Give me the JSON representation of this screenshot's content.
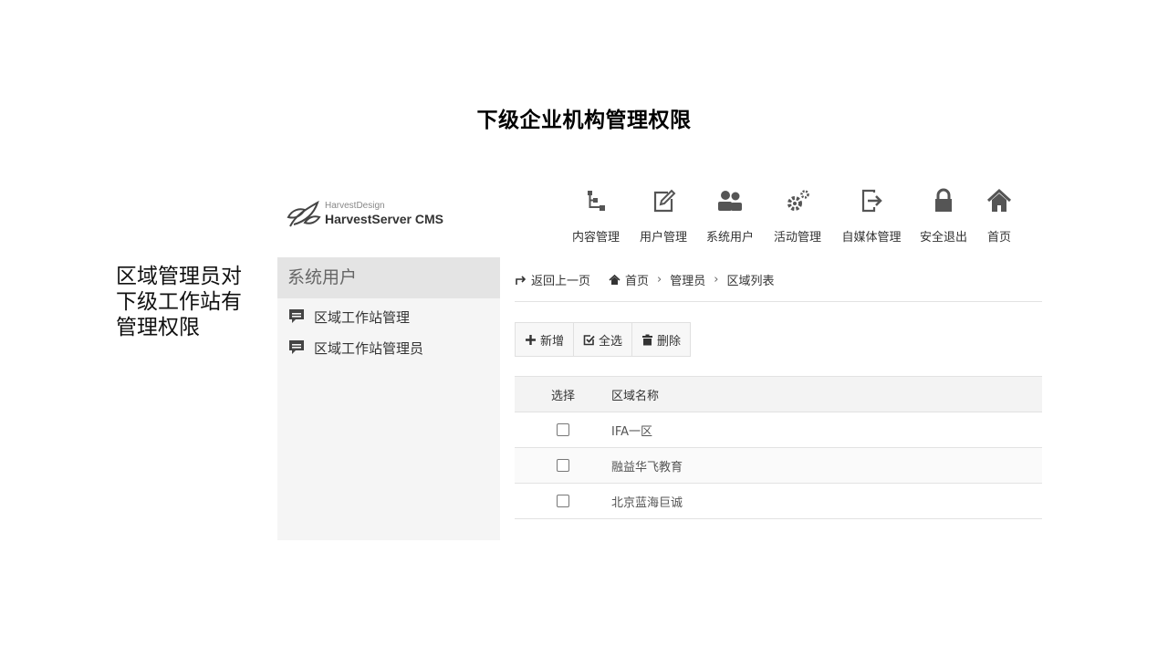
{
  "slide": {
    "title": "下级企业机构管理权限",
    "note_lines": [
      "区域管理员对",
      "下级工作站有",
      "管理权限"
    ]
  },
  "logo": {
    "small": "HarvestDesign",
    "big": "HarvestServer CMS"
  },
  "nav": [
    {
      "label": "内容管理",
      "icon": "sitemap-icon"
    },
    {
      "label": "用户管理",
      "icon": "edit-icon"
    },
    {
      "label": "系统用户",
      "icon": "users-icon"
    },
    {
      "label": "活动管理",
      "icon": "gears-icon"
    },
    {
      "label": "自媒体管理",
      "icon": "export-icon"
    },
    {
      "label": "安全退出",
      "icon": "lock-icon"
    },
    {
      "label": "首页",
      "icon": "home-icon"
    }
  ],
  "sidebar": {
    "title": "系统用户",
    "items": [
      {
        "label": "区域工作站管理",
        "icon": "comment-icon"
      },
      {
        "label": "区域工作站管理员",
        "icon": "comment-icon"
      }
    ]
  },
  "breadcrumb": {
    "back": "返回上一页",
    "home": "首页",
    "level1": "管理员",
    "level2": "区域列表"
  },
  "toolbar": {
    "add": "新增",
    "select_all": "全选",
    "delete": "删除"
  },
  "table": {
    "headers": [
      "选择",
      "区域名称"
    ],
    "rows": [
      {
        "name": "IFA一区",
        "checked": false
      },
      {
        "name": "融益华飞教育",
        "checked": false
      },
      {
        "name": "北京蓝海巨诚",
        "checked": false
      }
    ]
  }
}
